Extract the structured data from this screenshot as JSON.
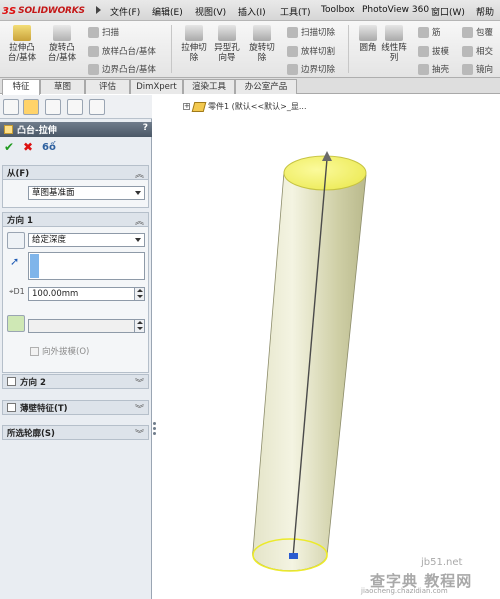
{
  "app": {
    "logo_ds": "3S",
    "logo_name": "SOLIDWORKS"
  },
  "menu": [
    {
      "label": "文件(F)"
    },
    {
      "label": "编辑(E)"
    },
    {
      "label": "视图(V)"
    },
    {
      "label": "插入(I)"
    },
    {
      "label": "工具(T)"
    },
    {
      "label": "Toolbox"
    },
    {
      "label": "PhotoView 360"
    },
    {
      "label": "窗口(W)"
    },
    {
      "label": "帮助"
    }
  ],
  "toolbar": {
    "extrude_boss": "拉伸凸\n台/基体",
    "revolve_boss": "旋转凸\n台/基体",
    "sweep": "扫描",
    "loft": "放样凸台/基体",
    "boundary_boss": "边界凸台/基体",
    "extrude_cut": "拉伸切\n除",
    "hole_wizard": "异型孔\n向导",
    "revolve_cut": "旋转切\n除",
    "swept_cut": "扫描切除",
    "lofted_cut": "放样切割",
    "boundary_cut": "边界切除",
    "fillet": "圆角",
    "linear_pattern": "线性阵\n列",
    "rib": "筋",
    "draft": "拔模",
    "shell": "抽壳",
    "wrap": "包覆",
    "intersect": "相交",
    "mirror": "镜向"
  },
  "tabs": [
    {
      "label": "特征",
      "active": true
    },
    {
      "label": "草图",
      "active": false
    },
    {
      "label": "评估",
      "active": false
    },
    {
      "label": "DimXpert",
      "active": false
    },
    {
      "label": "渲染工具",
      "active": false
    },
    {
      "label": "办公室产品",
      "active": false
    }
  ],
  "property_manager": {
    "title": "凸台-拉伸",
    "help": "?",
    "from": {
      "header": "从(F)",
      "value": "草图基准面"
    },
    "direction1": {
      "header": "方向 1",
      "end_condition": "给定深度",
      "depth": "100.00mm",
      "draft_outward_label": "向外拔模(O)"
    },
    "direction2": {
      "header": "方向 2"
    },
    "thin_feature": {
      "header": "薄壁特征(T)"
    },
    "selected_contours": {
      "header": "所选轮廓(S)"
    }
  },
  "feature_tree": {
    "item": "零件1 (默认<<默认>_显..."
  },
  "watermark": {
    "site": "jb51.net",
    "name": "查字典 教程网",
    "url": "jiaocheng.chazidian.com"
  },
  "colors": {
    "cylinder_body": "#d8d8b0",
    "cylinder_top": "#f1f06a",
    "highlight_edge": "#f2ee28"
  }
}
